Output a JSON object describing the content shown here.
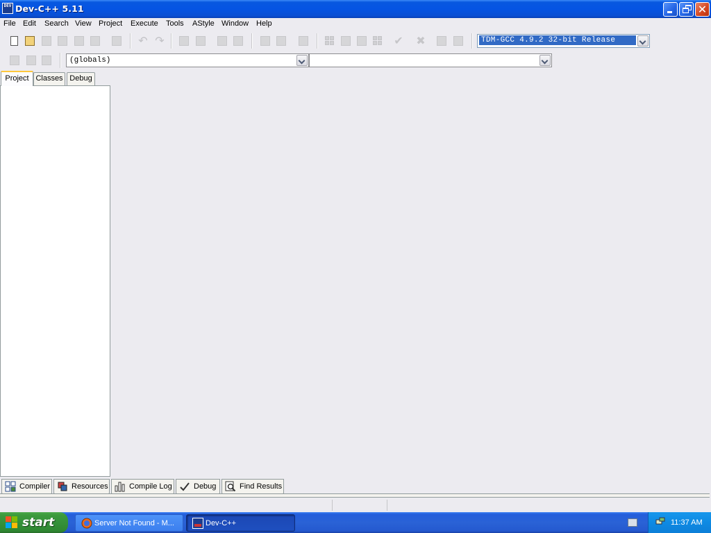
{
  "window": {
    "title": "Dev-C++ 5.11",
    "icon": "devcpp-icon",
    "icon_text": "DEV"
  },
  "menu": {
    "items": [
      "File",
      "Edit",
      "Search",
      "View",
      "Project",
      "Execute",
      "Tools",
      "AStyle",
      "Window",
      "Help"
    ]
  },
  "toolbar": {
    "compiler_select": "TDM-GCC 4.9.2 32-bit Release",
    "scope_select": "(globals)",
    "member_select": ""
  },
  "left_panel": {
    "tabs": [
      "Project",
      "Classes",
      "Debug"
    ],
    "active_tab": "Project"
  },
  "bottom_panel": {
    "tabs": [
      "Compiler",
      "Resources",
      "Compile Log",
      "Debug",
      "Find Results"
    ]
  },
  "taskbar": {
    "start_label": "start",
    "tasks": [
      {
        "label": "Server Not Found - M...",
        "active": false
      },
      {
        "label": "Dev-C++",
        "active": true
      }
    ],
    "clock": "11:37 AM"
  },
  "colors": {
    "titlebar": "#0554e3",
    "taskbar": "#245edb",
    "start": "#35913a",
    "selection": "#316ac5"
  }
}
